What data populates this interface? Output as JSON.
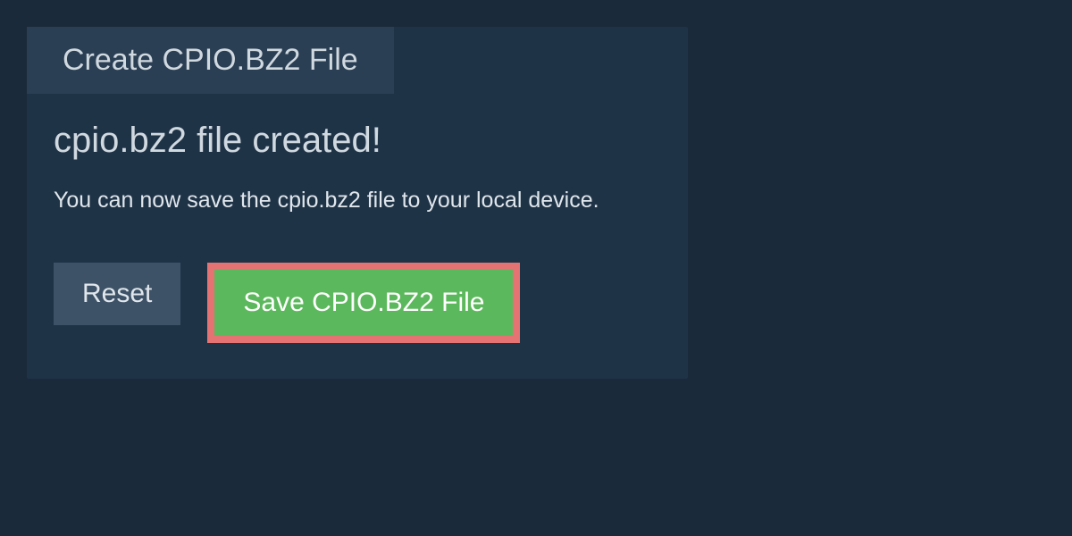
{
  "tab": {
    "title": "Create CPIO.BZ2 File"
  },
  "status": {
    "heading": "cpio.bz2 file created!",
    "description": "You can now save the cpio.bz2 file to your local device."
  },
  "buttons": {
    "reset_label": "Reset",
    "save_label": "Save CPIO.BZ2 File"
  }
}
